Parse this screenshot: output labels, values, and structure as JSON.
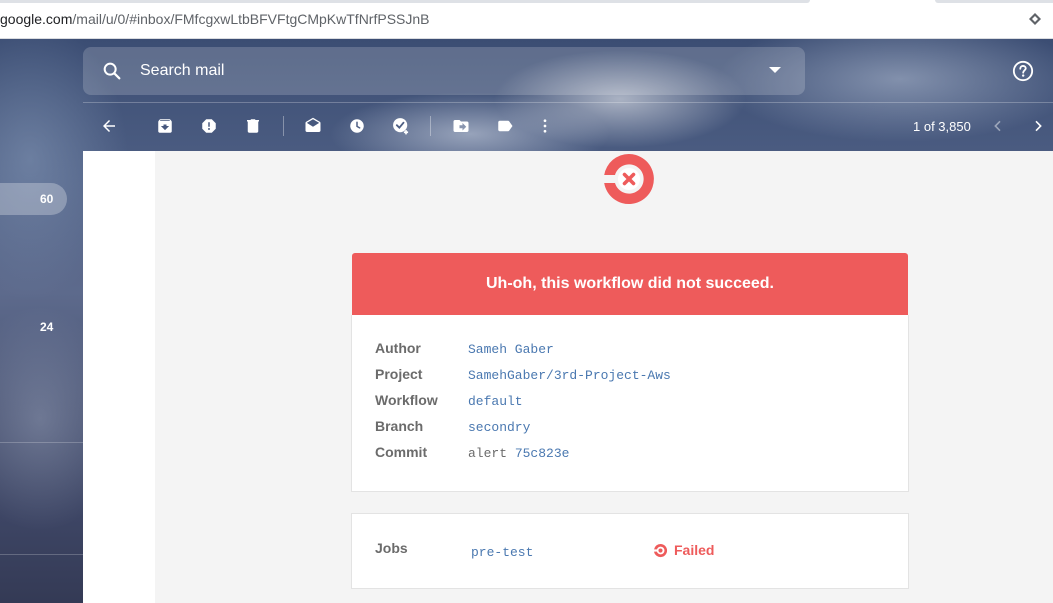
{
  "browser": {
    "url_host": "google.com",
    "url_path": "/mail/u/0/#inbox/FMfcgxwLtbBFVFtgCMpKwTfNrfPSSJnB"
  },
  "search": {
    "placeholder": "Search mail",
    "icon": "search-icon"
  },
  "toolbar": {
    "counter": "1 of 3,850",
    "icons": [
      "back-arrow-icon",
      "archive-icon",
      "report-spam-icon",
      "delete-icon",
      "mark-unread-icon",
      "snooze-icon",
      "add-task-icon",
      "move-to-icon",
      "label-icon",
      "more-vert-icon"
    ]
  },
  "nav": {
    "counts": [
      "60",
      "24"
    ]
  },
  "email": {
    "banner": "Uh-oh, this workflow did not succeed.",
    "details": [
      {
        "key": "Author",
        "value": "Sameh Gaber"
      },
      {
        "key": "Project",
        "value": "SamehGaber/3rd-Project-Aws"
      },
      {
        "key": "Workflow",
        "value": "default"
      },
      {
        "key": "Branch",
        "value": "secondry"
      },
      {
        "key": "Commit",
        "value_prefix": "alert",
        "value": "75c823e"
      }
    ],
    "jobs": {
      "label": "Jobs",
      "name": "pre-test",
      "status": "Failed"
    }
  },
  "colors": {
    "accent_red": "#ee5b5b",
    "link_blue": "#4a78b0",
    "label_gray": "#6b6b6b"
  }
}
